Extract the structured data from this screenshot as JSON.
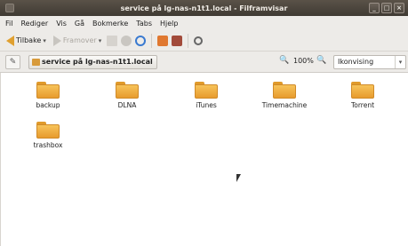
{
  "window": {
    "title": "service på lg-nas-n1t1.local - Filframvisar",
    "controls": [
      "_",
      "□",
      "×"
    ]
  },
  "menu": [
    "Fil",
    "Rediger",
    "Vis",
    "Gå",
    "Bokmerke",
    "Tabs",
    "Hjelp"
  ],
  "toolbar": {
    "back_label": "Tilbake",
    "forward_label": "Framover"
  },
  "location": {
    "crumb": "service på lg-nas-n1t1.local",
    "zoom": "100%",
    "view_mode": "Ikonvising"
  },
  "files": [
    {
      "name": "backup"
    },
    {
      "name": "DLNA"
    },
    {
      "name": "iTunes"
    },
    {
      "name": "Timemachine"
    },
    {
      "name": "Torrent"
    },
    {
      "name": "trashbox"
    }
  ]
}
